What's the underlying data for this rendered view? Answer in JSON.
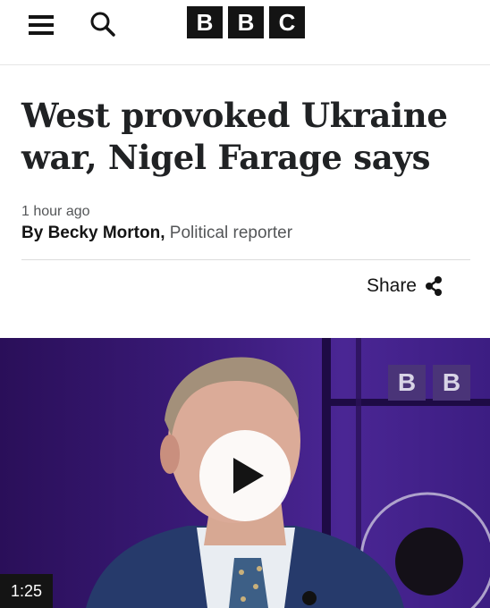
{
  "header": {
    "menu_icon": "hamburger-menu-icon",
    "search_icon": "search-icon",
    "logo_letters": [
      "B",
      "B",
      "C"
    ]
  },
  "article": {
    "headline": "West provoked Ukraine war, Nigel Farage says",
    "timestamp": "1 hour ago",
    "byline_prefix": "By",
    "author": "Becky Morton,",
    "role": "Political reporter",
    "share_label": "Share",
    "share_icon": "share-icon"
  },
  "video": {
    "duration": "1:25",
    "play_icon": "play-icon",
    "studio_logo_letters": [
      "B",
      "B"
    ]
  },
  "colors": {
    "brand": "#141414",
    "video_bg": "#3a1a78"
  }
}
